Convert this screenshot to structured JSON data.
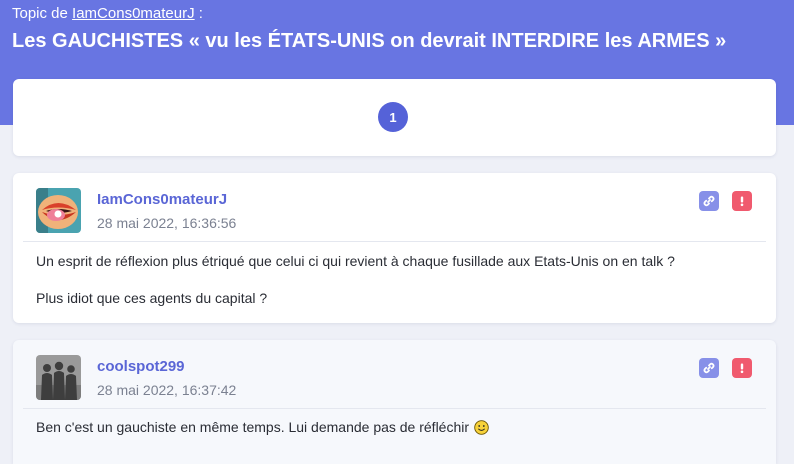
{
  "topic": {
    "prefix": "Topic de",
    "author": "IamCons0mateurJ",
    "suffix": ":",
    "title": "Les GAUCHISTES « vu les ÉTATS-UNIS on devrait INTERDIRE les ARMES »"
  },
  "pagination": {
    "current_page": "1"
  },
  "posts": [
    {
      "author": "IamCons0mateurJ",
      "date": "28 mai 2022, 16:36:56",
      "lines": [
        "Un esprit de réflexion plus étriqué que celui ci qui revient à chaque fusillade aux Etats-Unis on en talk ?",
        "Plus idiot que ces agents du capital ?"
      ]
    },
    {
      "author": "coolspot299",
      "date": "28 mai 2022, 16:37:42",
      "lines": [
        "Ben c'est un gauchiste en même temps. Lui demande pas de réfléchir"
      ],
      "emoji": "smiley-icon"
    }
  ],
  "colors": {
    "header": "#6875e2",
    "author": "#5a66d6",
    "link_button": "#8790e8",
    "report_button": "#f05a6e"
  }
}
